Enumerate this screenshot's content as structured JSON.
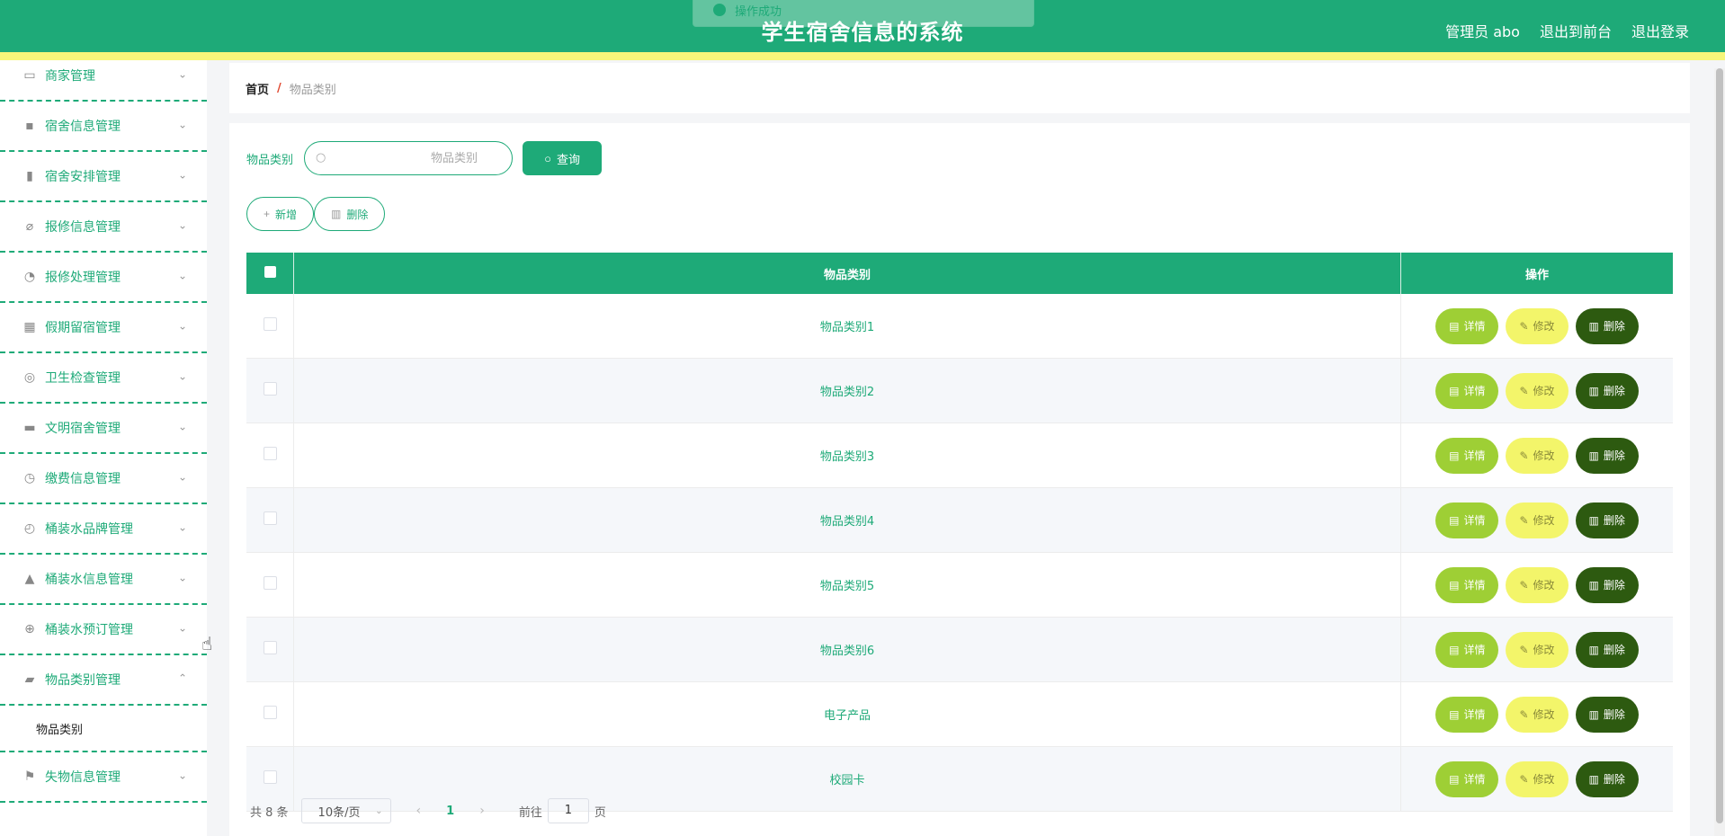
{
  "header": {
    "title": "学生宿舍信息的系统",
    "user_label": "管理员 abo",
    "to_front_label": "退出到前台",
    "logout_label": "退出登录",
    "toast_text": "操作成功"
  },
  "sidebar": {
    "items": [
      {
        "label": "商家管理",
        "icon": "card-icon",
        "glyph": "▭"
      },
      {
        "label": "宿舍信息管理",
        "icon": "briefcase-icon",
        "glyph": "▪"
      },
      {
        "label": "宿舍安排管理",
        "icon": "clipboard-icon",
        "glyph": "▮"
      },
      {
        "label": "报修信息管理",
        "icon": "bell-off-icon",
        "glyph": "⌀"
      },
      {
        "label": "报修处理管理",
        "icon": "gauge-icon",
        "glyph": "◔"
      },
      {
        "label": "假期留宿管理",
        "icon": "grid-icon",
        "glyph": "▦"
      },
      {
        "label": "卫生检查管理",
        "icon": "lifebuoy-icon",
        "glyph": "◎"
      },
      {
        "label": "文明宿舍管理",
        "icon": "chat-icon",
        "glyph": "▬"
      },
      {
        "label": "缴费信息管理",
        "icon": "clock-icon",
        "glyph": "◷"
      },
      {
        "label": "桶装水品牌管理",
        "icon": "compass-icon",
        "glyph": "◴"
      },
      {
        "label": "桶装水信息管理",
        "icon": "user-icon",
        "glyph": "▲"
      },
      {
        "label": "桶装水预订管理",
        "icon": "crosshair-icon",
        "glyph": "⊕"
      },
      {
        "label": "物品类别管理",
        "icon": "ticket-icon",
        "glyph": "▰"
      }
    ],
    "submenu_label": "物品类别",
    "last_item": {
      "label": "失物信息管理",
      "icon": "flag-icon",
      "glyph": "⚑"
    }
  },
  "breadcrumb": {
    "home": "首页",
    "separator": "/",
    "current": "物品类别"
  },
  "search": {
    "label": "物品类别",
    "placeholder": "物品类别",
    "query_label": "查询"
  },
  "actions": {
    "add_label": "新增",
    "delete_label": "删除"
  },
  "table": {
    "columns": [
      "物品类别",
      "操作"
    ],
    "rows": [
      {
        "name": "物品类别1"
      },
      {
        "name": "物品类别2"
      },
      {
        "name": "物品类别3"
      },
      {
        "name": "物品类别4"
      },
      {
        "name": "物品类别5"
      },
      {
        "name": "物品类别6"
      },
      {
        "name": "电子产品"
      },
      {
        "name": "校园卡"
      }
    ],
    "detail_label": "详情",
    "edit_label": "修改",
    "delete_label": "删除"
  },
  "pagination": {
    "total_text": "共 8 条",
    "page_size": "10条/页",
    "current_page": "1",
    "goto_prefix": "前往",
    "goto_value": "1",
    "goto_suffix": "页"
  },
  "colors": {
    "primary": "#1eaa78",
    "accent_yellow": "#f6f67a",
    "detail_btn": "#9ecf35",
    "edit_btn": "#f3f56a",
    "delete_btn": "#2d5a10"
  }
}
